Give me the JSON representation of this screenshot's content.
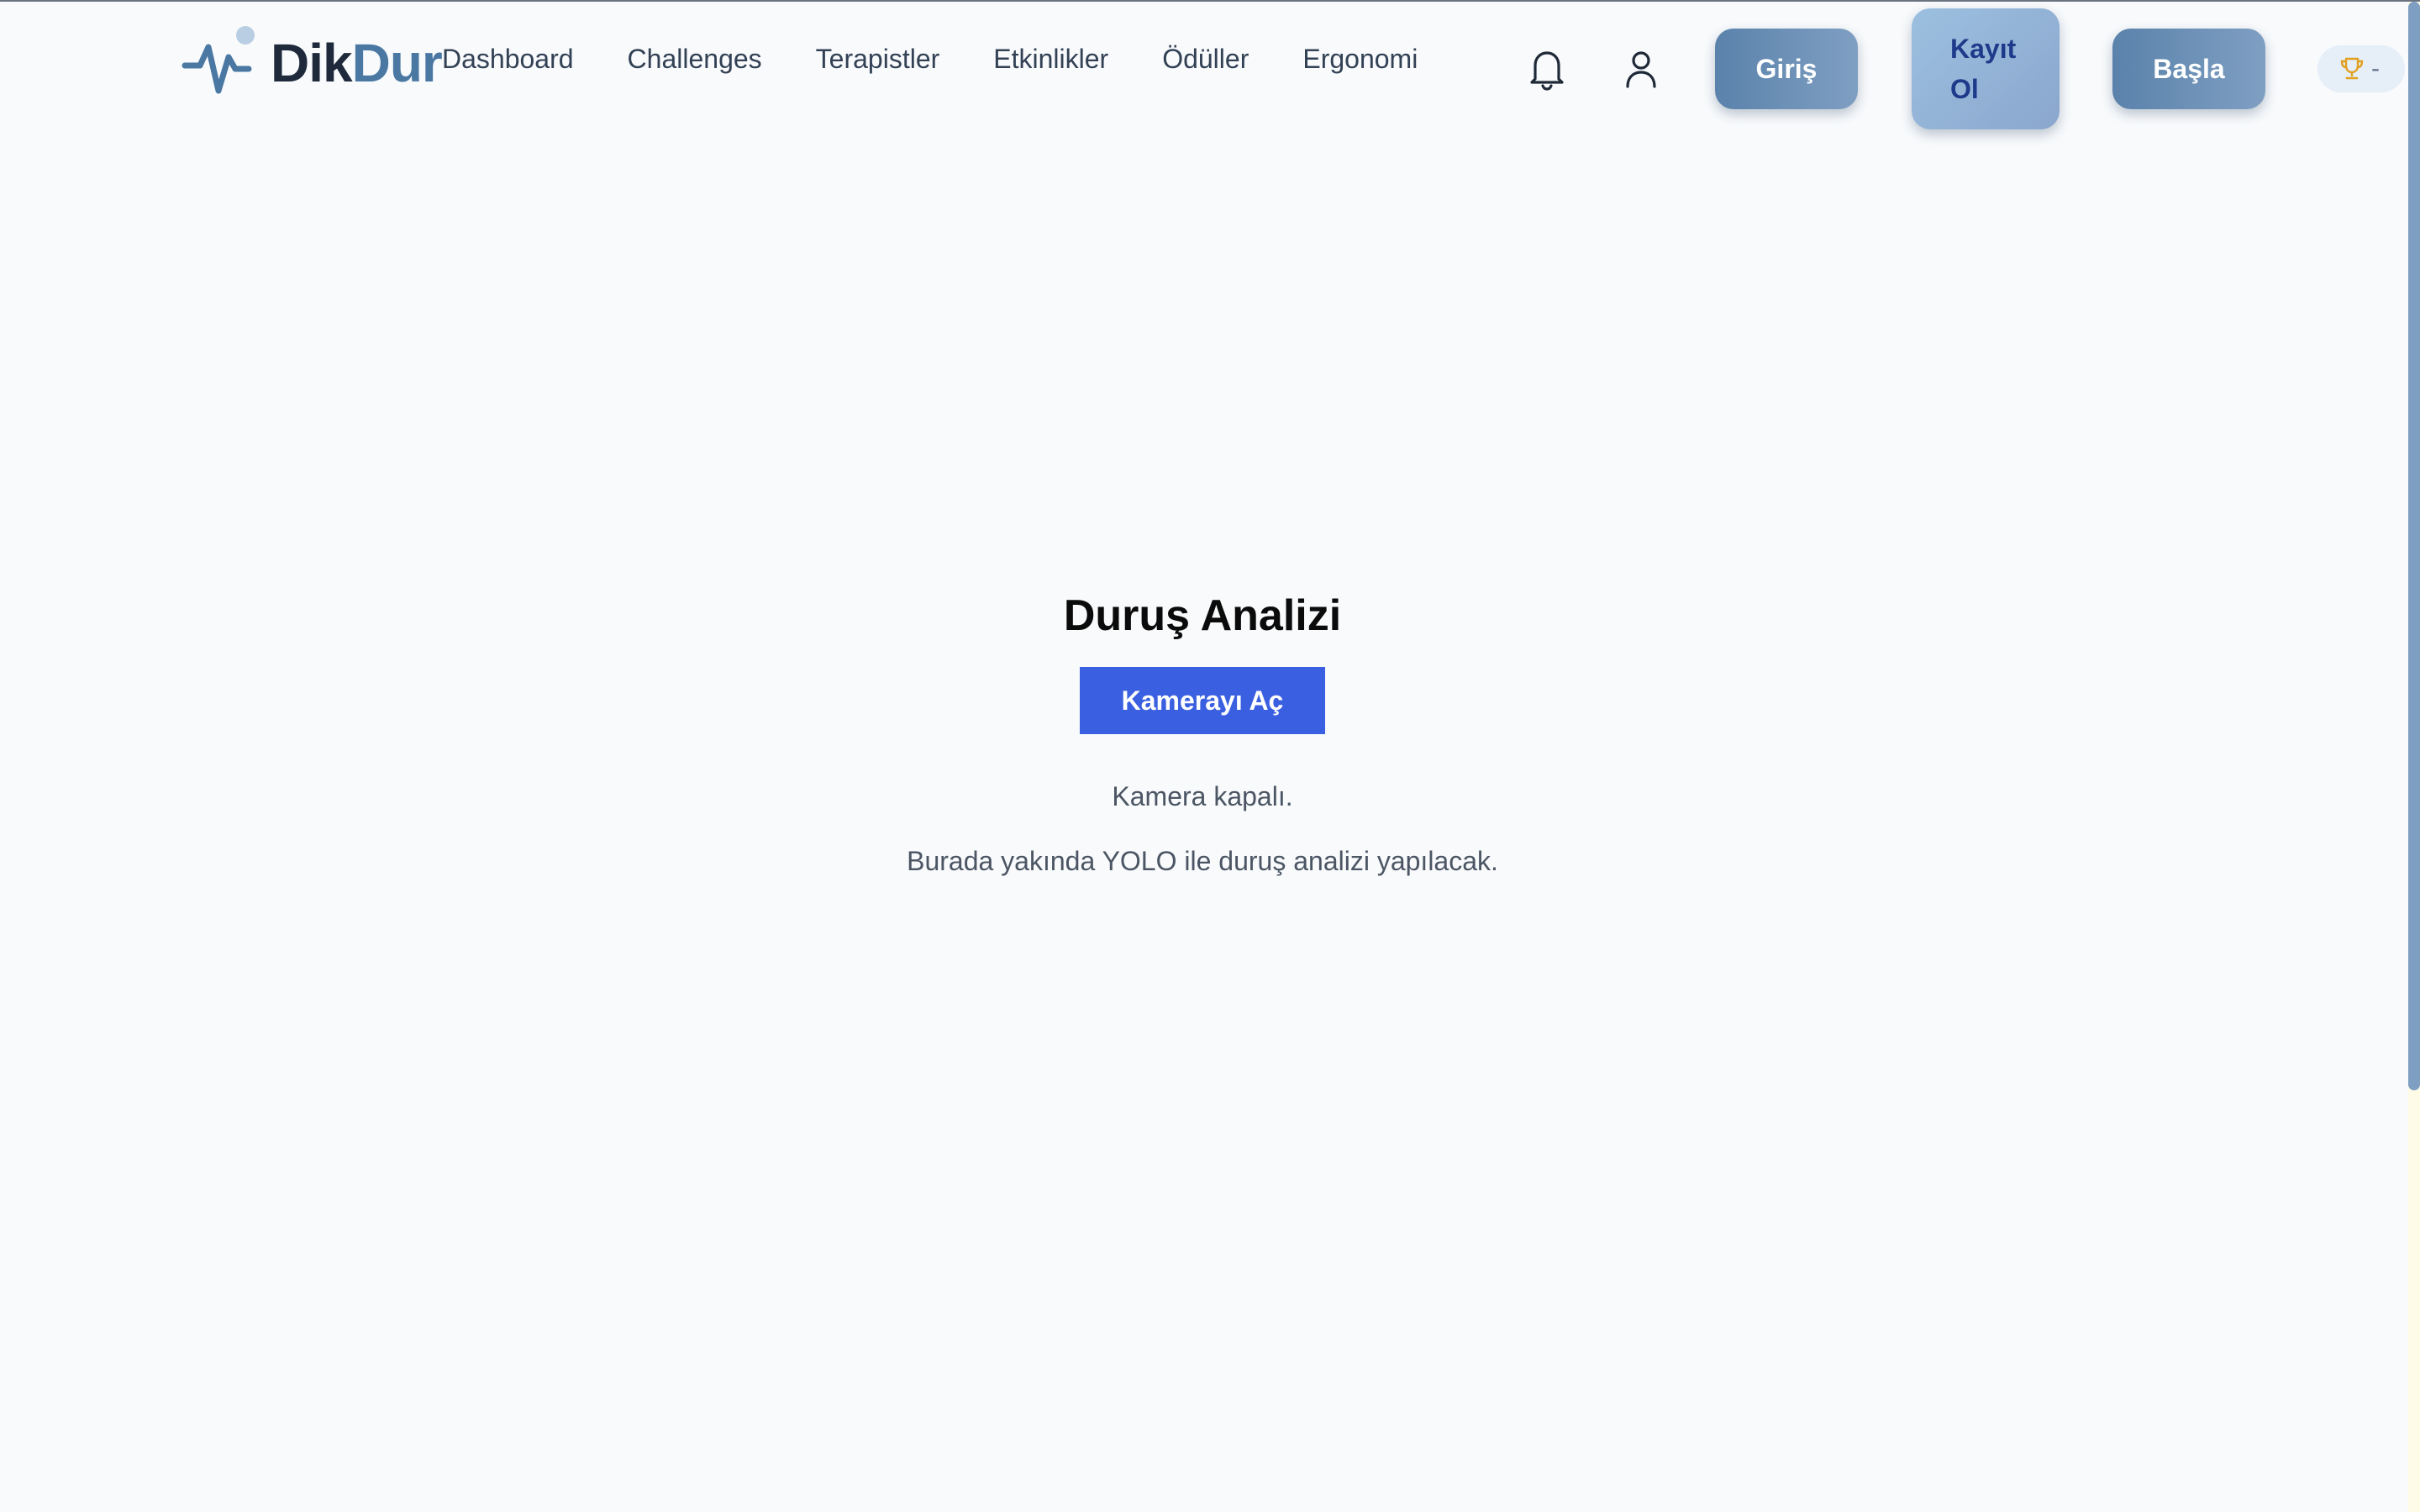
{
  "brand": {
    "name_part1": "Dik",
    "name_part2": "Dur",
    "logo_icon": "pulse-icon"
  },
  "nav": {
    "links": [
      {
        "label": "Dashboard"
      },
      {
        "label": "Challenges"
      },
      {
        "label": "Terapistler"
      },
      {
        "label": "Etkinlikler"
      },
      {
        "label": "Ödüller"
      },
      {
        "label": "Ergonomi"
      }
    ],
    "icons": [
      "bell-icon",
      "user-icon"
    ],
    "login_label": "Giriş",
    "register_line1": "Kayıt",
    "register_line2": "Ol",
    "start_label": "Başla",
    "score_value": "-"
  },
  "main": {
    "title": "Duruş Analizi",
    "camera_button": "Kamerayı Aç",
    "status": "Kamera kapalı.",
    "description": "Burada yakında YOLO ile duruş analizi yapılacak."
  },
  "colors": {
    "page_bg": "#f8fafc",
    "brand_dark": "#1e293b",
    "brand_accent": "#4a78a3",
    "primary_button": "#3a5fe0",
    "trophy": "#e0a020"
  }
}
